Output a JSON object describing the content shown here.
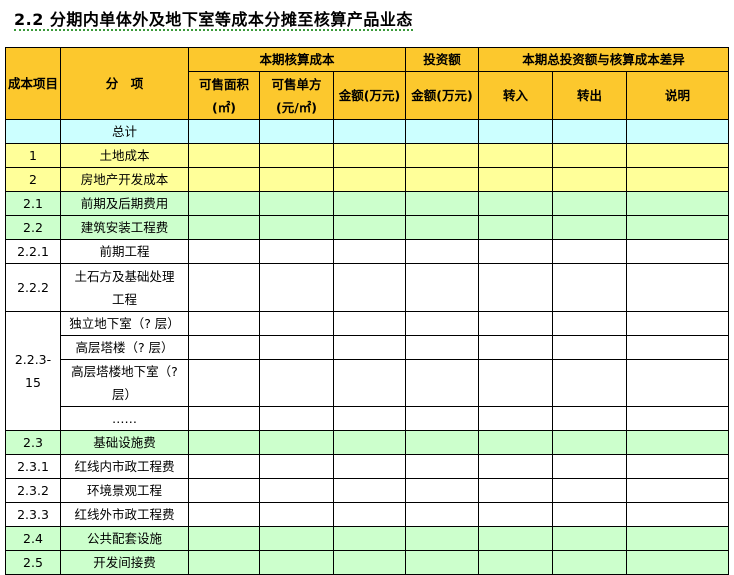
{
  "title": "2.2 分期内单体外及地下室等成本分摊至核算产品业态",
  "headers": {
    "cost_item": "成本项目",
    "category": "分　项",
    "current_cost": "本期核算成本",
    "investment": "投资额",
    "diff": "本期总投资额与核算成本差异",
    "area": "可售面积(㎡)",
    "unit_price": "可售单方(元/㎡)",
    "amount": "金额(万元)",
    "inv_amount": "金额(万元)",
    "transfer_in": "转入",
    "transfer_out": "转出",
    "note": "说明"
  },
  "rows": [
    {
      "code": "",
      "name": "总计"
    },
    {
      "code": "1",
      "name": "土地成本"
    },
    {
      "code": "2",
      "name": "房地产开发成本"
    },
    {
      "code": "2.1",
      "name": "前期及后期费用"
    },
    {
      "code": "2.2",
      "name": "建筑安装工程费"
    },
    {
      "code": "2.2.1",
      "name": "前期工程"
    },
    {
      "code": "2.2.2",
      "name": "土石方及基础处理工程"
    },
    {
      "code": "2.2.3-15",
      "name": "独立地下室（? 层）"
    },
    {
      "code": "",
      "name": "高层塔楼（? 层）"
    },
    {
      "code": "",
      "name": "高层塔楼地下室（? 层）"
    },
    {
      "code": "",
      "name": "……"
    },
    {
      "code": "2.3",
      "name": "基础设施费"
    },
    {
      "code": "2.3.1",
      "name": "红线内市政工程费"
    },
    {
      "code": "2.3.2",
      "name": "环境景观工程"
    },
    {
      "code": "2.3.3",
      "name": "红线外市政工程费"
    },
    {
      "code": "2.4",
      "name": "公共配套设施"
    },
    {
      "code": "2.5",
      "name": "开发间接费"
    }
  ]
}
